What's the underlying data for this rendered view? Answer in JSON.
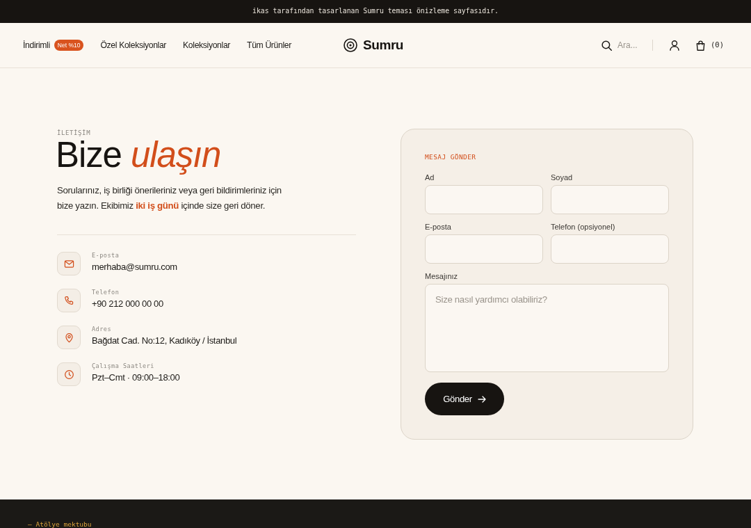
{
  "announcement": {
    "text": "ikas tarafından tasarlanan Sumru teması önizleme sayfasıdır."
  },
  "header": {
    "nav": [
      {
        "label": "İndirimli",
        "badge": "Net %10"
      },
      {
        "label": "Özel Koleksiyonlar"
      },
      {
        "label": "Koleksiyonlar"
      },
      {
        "label": "Tüm Ürünler"
      }
    ],
    "logo": "Sumru",
    "search": {
      "placeholder": "Ara..."
    },
    "cart": {
      "count": "(0)"
    }
  },
  "contact": {
    "eyebrow": "İLETİŞİM",
    "title": "Bize *ulaşın*",
    "intro": "Sorularınız, iş birliği önerileriniz veya geri bildirimleriniz için bize yazın. Ekibimiz **iki iş günü** içinde size geri döner.",
    "items": [
      {
        "kind": "email",
        "label": "E-posta",
        "value": "merhaba@sumru.com"
      },
      {
        "kind": "phone",
        "label": "Telefon",
        "value": "+90 212 000 00 00"
      },
      {
        "kind": "address",
        "label": "Adres",
        "value": "Bağdat Cad. No:12, Kadıköy / İstanbul"
      },
      {
        "kind": "hours",
        "label": "Çalışma Saatleri",
        "value": "Pzt–Cmt · 09:00–18:00"
      }
    ]
  },
  "form": {
    "eyebrow": "MESAJ GÖNDER",
    "fields": [
      {
        "kind": "input",
        "label": "Ad"
      },
      {
        "kind": "input",
        "label": "Soyad"
      },
      {
        "kind": "input",
        "label": "E-posta"
      },
      {
        "kind": "input",
        "label": "Telefon (opsiyonel)"
      },
      {
        "kind": "textarea",
        "label": "Mesajınız",
        "placeholder": "Size nasıl yardımcı olabiliriz?"
      }
    ],
    "submit": "Gönder"
  },
  "footer": {
    "text": "— Atölye mektubu"
  }
}
